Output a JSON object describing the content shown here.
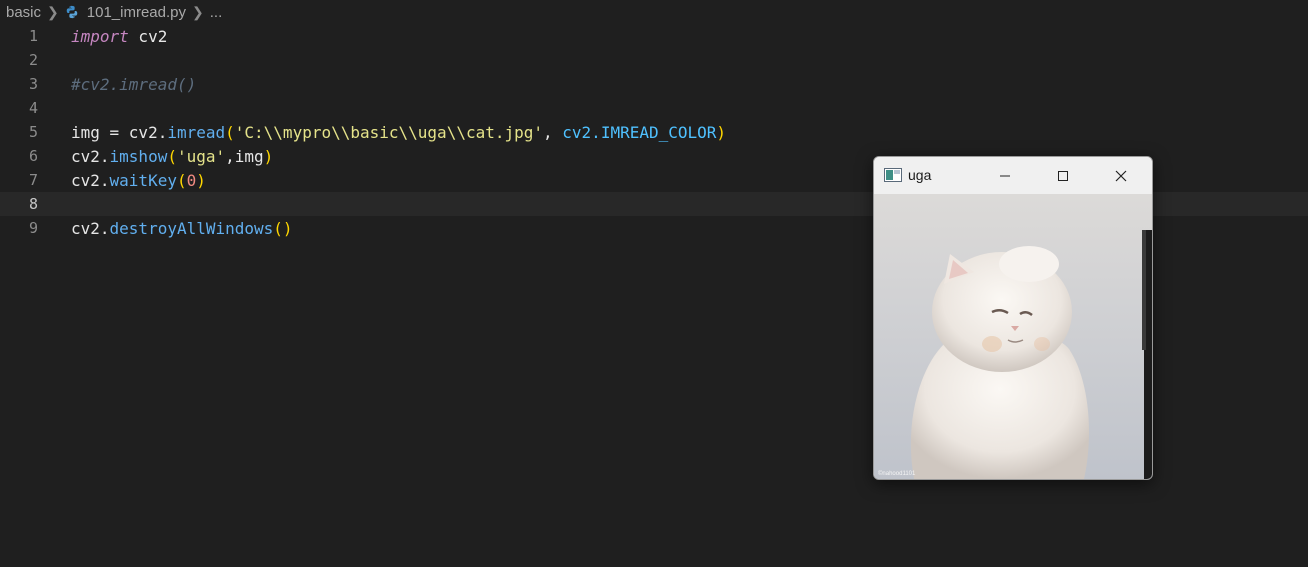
{
  "breadcrumb": {
    "folder": "basic",
    "file": "101_imread.py",
    "more": "..."
  },
  "editor": {
    "current_line": 8,
    "line_numbers": [
      "1",
      "2",
      "3",
      "4",
      "5",
      "6",
      "7",
      "8",
      "9"
    ],
    "lines": {
      "l1": {
        "kw": "import",
        "rest": " cv2"
      },
      "l3": {
        "comment": "#cv2.imread()"
      },
      "l5": {
        "a": "img = cv2.",
        "fn": "imread",
        "p1": "(",
        "str": "'C:\\\\mypro\\\\basic\\\\uga\\\\cat.jpg'",
        "comma": ", ",
        "cv": "cv2.",
        "const": "IMREAD_COLOR",
        "p2": ")"
      },
      "l6": {
        "a": "cv2.",
        "fn": "imshow",
        "p1": "(",
        "str": "'uga'",
        "b": ",img",
        "p2": ")"
      },
      "l7": {
        "a": "cv2.",
        "fn": "waitKey",
        "p1": "(",
        "num": "0",
        "p2": ")"
      },
      "l9": {
        "a": "cv2.",
        "fn": "destroyAllWindows",
        "p": "()"
      }
    }
  },
  "cv_window": {
    "title": "uga",
    "image_subject": "white fluffy cat photo",
    "watermark": "©nahood1101"
  },
  "colors": {
    "background": "#1f1f1f",
    "keyword": "#c586c0",
    "function": "#61afef",
    "string": "#e5e38a",
    "constant": "#4fc1ff",
    "number": "#f28b82",
    "comment": "#5d6d7e"
  },
  "icons": [
    "chevron-right-icon",
    "python-file-icon",
    "window-app-icon",
    "minimize-icon",
    "maximize-icon",
    "close-icon"
  ]
}
